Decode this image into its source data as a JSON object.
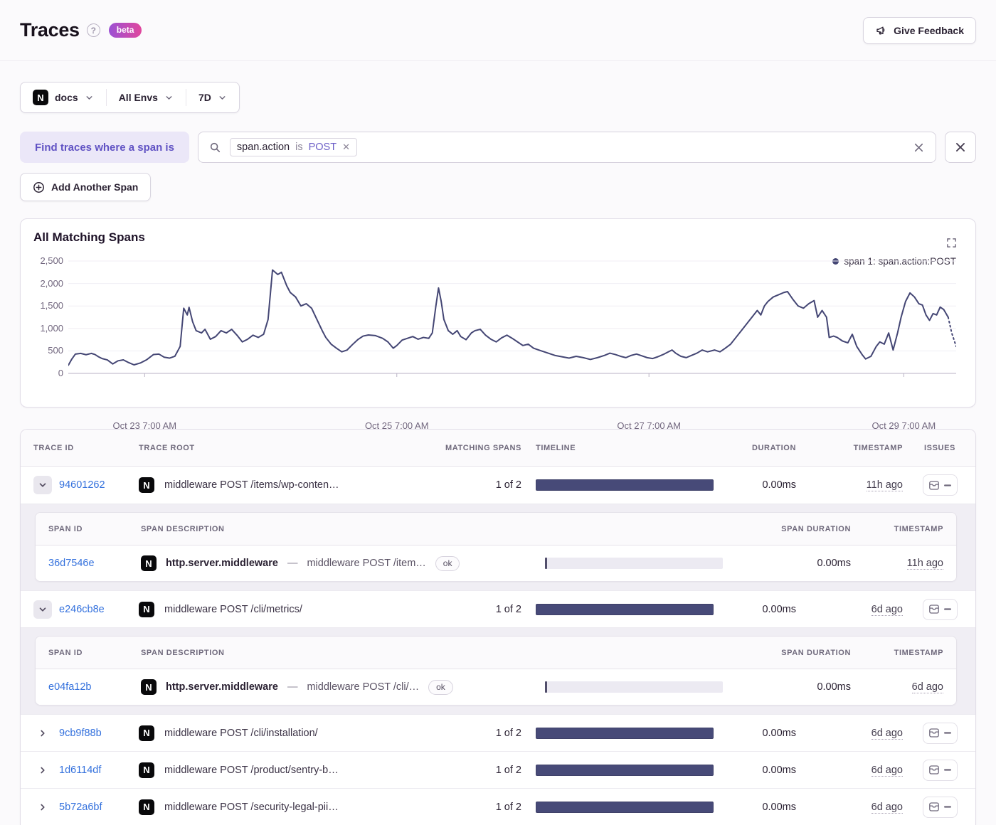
{
  "header": {
    "title": "Traces",
    "beta_badge": "beta",
    "feedback_label": "Give Feedback"
  },
  "filters": {
    "project": "docs",
    "environment": "All Envs",
    "period": "7D"
  },
  "span_query": {
    "label": "Find traces where a span is",
    "token": {
      "key": "span.action",
      "op": "is",
      "value": "POST"
    },
    "add_label": "Add Another Span"
  },
  "chart": {
    "title": "All Matching Spans",
    "legend": "span 1: span.action:POST"
  },
  "chart_data": {
    "type": "line",
    "title": "All Matching Spans",
    "legend_entries": [
      "span 1: span.action:POST"
    ],
    "legend_position": "top-right",
    "line_color": "#444674",
    "grid": true,
    "ylim": [
      0,
      2500
    ],
    "y_ticks": [
      {
        "label": "0",
        "value": 0
      },
      {
        "label": "500",
        "value": 500
      },
      {
        "label": "1,000",
        "value": 1000
      },
      {
        "label": "1,500",
        "value": 1500
      },
      {
        "label": "2,000",
        "value": 2000
      },
      {
        "label": "2,500",
        "value": 2500
      }
    ],
    "x_ticks": [
      {
        "label": "Oct 23 7:00 AM",
        "frac": 0.086
      },
      {
        "label": "Oct 25 7:00 AM",
        "frac": 0.37
      },
      {
        "label": "Oct 27 7:00 AM",
        "frac": 0.654
      },
      {
        "label": "Oct 29 7:00 AM",
        "frac": 0.941
      }
    ],
    "dashed_tail_points": 3,
    "points": [
      [
        0.0,
        180
      ],
      [
        0.004,
        320
      ],
      [
        0.008,
        430
      ],
      [
        0.014,
        445
      ],
      [
        0.02,
        415
      ],
      [
        0.026,
        445
      ],
      [
        0.03,
        420
      ],
      [
        0.034,
        370
      ],
      [
        0.038,
        330
      ],
      [
        0.044,
        300
      ],
      [
        0.05,
        210
      ],
      [
        0.056,
        280
      ],
      [
        0.062,
        300
      ],
      [
        0.068,
        240
      ],
      [
        0.074,
        190
      ],
      [
        0.081,
        230
      ],
      [
        0.088,
        300
      ],
      [
        0.096,
        420
      ],
      [
        0.102,
        430
      ],
      [
        0.108,
        360
      ],
      [
        0.114,
        340
      ],
      [
        0.12,
        380
      ],
      [
        0.126,
        600
      ],
      [
        0.13,
        1450
      ],
      [
        0.134,
        1300
      ],
      [
        0.136,
        1470
      ],
      [
        0.14,
        1150
      ],
      [
        0.144,
        950
      ],
      [
        0.15,
        900
      ],
      [
        0.154,
        980
      ],
      [
        0.16,
        760
      ],
      [
        0.166,
        820
      ],
      [
        0.172,
        950
      ],
      [
        0.178,
        900
      ],
      [
        0.184,
        980
      ],
      [
        0.19,
        850
      ],
      [
        0.196,
        700
      ],
      [
        0.202,
        760
      ],
      [
        0.208,
        850
      ],
      [
        0.214,
        800
      ],
      [
        0.22,
        870
      ],
      [
        0.225,
        1200
      ],
      [
        0.23,
        2300
      ],
      [
        0.236,
        2200
      ],
      [
        0.24,
        2250
      ],
      [
        0.246,
        1950
      ],
      [
        0.25,
        1800
      ],
      [
        0.256,
        1700
      ],
      [
        0.262,
        1500
      ],
      [
        0.268,
        1550
      ],
      [
        0.274,
        1450
      ],
      [
        0.28,
        1200
      ],
      [
        0.286,
        950
      ],
      [
        0.29,
        800
      ],
      [
        0.296,
        650
      ],
      [
        0.302,
        560
      ],
      [
        0.308,
        480
      ],
      [
        0.314,
        520
      ],
      [
        0.32,
        640
      ],
      [
        0.326,
        750
      ],
      [
        0.332,
        830
      ],
      [
        0.338,
        855
      ],
      [
        0.346,
        840
      ],
      [
        0.354,
        780
      ],
      [
        0.36,
        700
      ],
      [
        0.366,
        560
      ],
      [
        0.37,
        620
      ],
      [
        0.376,
        740
      ],
      [
        0.382,
        780
      ],
      [
        0.388,
        820
      ],
      [
        0.394,
        760
      ],
      [
        0.4,
        800
      ],
      [
        0.406,
        780
      ],
      [
        0.41,
        900
      ],
      [
        0.414,
        1500
      ],
      [
        0.417,
        1900
      ],
      [
        0.42,
        1600
      ],
      [
        0.423,
        1200
      ],
      [
        0.428,
        950
      ],
      [
        0.433,
        870
      ],
      [
        0.438,
        950
      ],
      [
        0.442,
        820
      ],
      [
        0.448,
        750
      ],
      [
        0.454,
        900
      ],
      [
        0.458,
        950
      ],
      [
        0.464,
        980
      ],
      [
        0.47,
        850
      ],
      [
        0.476,
        760
      ],
      [
        0.482,
        700
      ],
      [
        0.488,
        790
      ],
      [
        0.494,
        850
      ],
      [
        0.5,
        780
      ],
      [
        0.506,
        700
      ],
      [
        0.512,
        620
      ],
      [
        0.518,
        650
      ],
      [
        0.524,
        560
      ],
      [
        0.53,
        520
      ],
      [
        0.536,
        480
      ],
      [
        0.542,
        440
      ],
      [
        0.548,
        400
      ],
      [
        0.556,
        370
      ],
      [
        0.564,
        340
      ],
      [
        0.572,
        380
      ],
      [
        0.58,
        350
      ],
      [
        0.588,
        310
      ],
      [
        0.596,
        350
      ],
      [
        0.604,
        400
      ],
      [
        0.61,
        450
      ],
      [
        0.616,
        420
      ],
      [
        0.622,
        380
      ],
      [
        0.628,
        350
      ],
      [
        0.634,
        400
      ],
      [
        0.64,
        430
      ],
      [
        0.646,
        390
      ],
      [
        0.652,
        350
      ],
      [
        0.658,
        330
      ],
      [
        0.664,
        370
      ],
      [
        0.67,
        420
      ],
      [
        0.676,
        480
      ],
      [
        0.68,
        520
      ],
      [
        0.684,
        450
      ],
      [
        0.69,
        380
      ],
      [
        0.696,
        350
      ],
      [
        0.702,
        400
      ],
      [
        0.708,
        450
      ],
      [
        0.714,
        520
      ],
      [
        0.72,
        480
      ],
      [
        0.728,
        520
      ],
      [
        0.734,
        480
      ],
      [
        0.74,
        560
      ],
      [
        0.746,
        650
      ],
      [
        0.752,
        800
      ],
      [
        0.758,
        950
      ],
      [
        0.764,
        1100
      ],
      [
        0.77,
        1250
      ],
      [
        0.776,
        1400
      ],
      [
        0.78,
        1300
      ],
      [
        0.784,
        1500
      ],
      [
        0.788,
        1600
      ],
      [
        0.794,
        1700
      ],
      [
        0.8,
        1750
      ],
      [
        0.806,
        1800
      ],
      [
        0.81,
        1820
      ],
      [
        0.816,
        1650
      ],
      [
        0.822,
        1500
      ],
      [
        0.828,
        1450
      ],
      [
        0.834,
        1550
      ],
      [
        0.84,
        1620
      ],
      [
        0.844,
        1250
      ],
      [
        0.849,
        1400
      ],
      [
        0.854,
        1250
      ],
      [
        0.857,
        800
      ],
      [
        0.862,
        830
      ],
      [
        0.866,
        800
      ],
      [
        0.872,
        720
      ],
      [
        0.878,
        680
      ],
      [
        0.883,
        870
      ],
      [
        0.888,
        600
      ],
      [
        0.894,
        420
      ],
      [
        0.898,
        320
      ],
      [
        0.904,
        380
      ],
      [
        0.91,
        600
      ],
      [
        0.914,
        700
      ],
      [
        0.919,
        650
      ],
      [
        0.924,
        900
      ],
      [
        0.929,
        520
      ],
      [
        0.934,
        900
      ],
      [
        0.938,
        1250
      ],
      [
        0.943,
        1600
      ],
      [
        0.948,
        1790
      ],
      [
        0.953,
        1700
      ],
      [
        0.958,
        1550
      ],
      [
        0.962,
        1520
      ],
      [
        0.966,
        1300
      ],
      [
        0.97,
        1180
      ],
      [
        0.974,
        1330
      ],
      [
        0.978,
        1300
      ],
      [
        0.982,
        1475
      ],
      [
        0.986,
        1420
      ],
      [
        0.991,
        1250
      ],
      [
        0.995,
        900
      ],
      [
        1.0,
        600
      ]
    ]
  },
  "table": {
    "columns": [
      "TRACE ID",
      "TRACE ROOT",
      "MATCHING SPANS",
      "TIMELINE",
      "DURATION",
      "TIMESTAMP",
      "ISSUES"
    ],
    "span_columns": [
      "SPAN ID",
      "SPAN DESCRIPTION",
      "",
      "SPAN DURATION",
      "TIMESTAMP"
    ],
    "rows": [
      {
        "trace_id": "94601262",
        "root": "middleware POST /items/wp-conten…",
        "matching": "1 of 2",
        "duration": "0.00ms",
        "timestamp": "11h ago",
        "expanded": true,
        "spans": [
          {
            "span_id": "36d7546e",
            "op": "http.server.middleware",
            "description": "middleware POST /item…",
            "status": "ok",
            "duration": "0.00ms",
            "timestamp": "11h ago"
          }
        ]
      },
      {
        "trace_id": "e246cb8e",
        "root": "middleware POST /cli/metrics/",
        "matching": "1 of 2",
        "duration": "0.00ms",
        "timestamp": "6d ago",
        "expanded": true,
        "spans": [
          {
            "span_id": "e04fa12b",
            "op": "http.server.middleware",
            "description": "middleware POST /cli/…",
            "status": "ok",
            "duration": "0.00ms",
            "timestamp": "6d ago"
          }
        ]
      },
      {
        "trace_id": "9cb9f88b",
        "root": "middleware POST /cli/installation/",
        "matching": "1 of 2",
        "duration": "0.00ms",
        "timestamp": "6d ago",
        "expanded": false,
        "spans": []
      },
      {
        "trace_id": "1d6114df",
        "root": "middleware POST /product/sentry-b…",
        "matching": "1 of 2",
        "duration": "0.00ms",
        "timestamp": "6d ago",
        "expanded": false,
        "spans": []
      },
      {
        "trace_id": "5b72a6bf",
        "root": "middleware POST /security-legal-pii…",
        "matching": "1 of 2",
        "duration": "0.00ms",
        "timestamp": "6d ago",
        "expanded": false,
        "spans": []
      }
    ]
  },
  "colors": {
    "accent_purple": "#6c5fc7",
    "chart_line": "#444674",
    "timeline_bar": "#474a78",
    "link_blue": "#3471dd",
    "beta_gradient_start": "#9b51d4",
    "beta_gradient_end": "#e1479d",
    "page_background": "#fbfafc"
  }
}
